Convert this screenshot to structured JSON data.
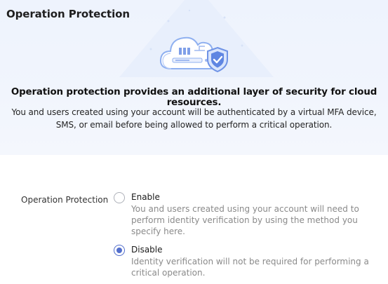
{
  "banner": {
    "title": "Operation Protection",
    "headline": "Operation protection provides an additional layer of security for cloud resources.",
    "description": "You and users created using your account will be authenticated by a virtual MFA device, SMS, or email before being allowed to perform a critical operation.",
    "illustration_icon": "cloud-shield-icon"
  },
  "form": {
    "label": "Operation Protection",
    "options": [
      {
        "label": "Enable",
        "description": "You and users created using your account will need to perform identity verification by using the method you specify here.",
        "selected": false
      },
      {
        "label": "Disable",
        "description": "Identity verification will not be required for performing a critical operation.",
        "selected": true
      }
    ]
  },
  "colors": {
    "accent": "#526ecc",
    "banner_bg": "#eef3fd",
    "muted_text": "#8a8a8a"
  }
}
